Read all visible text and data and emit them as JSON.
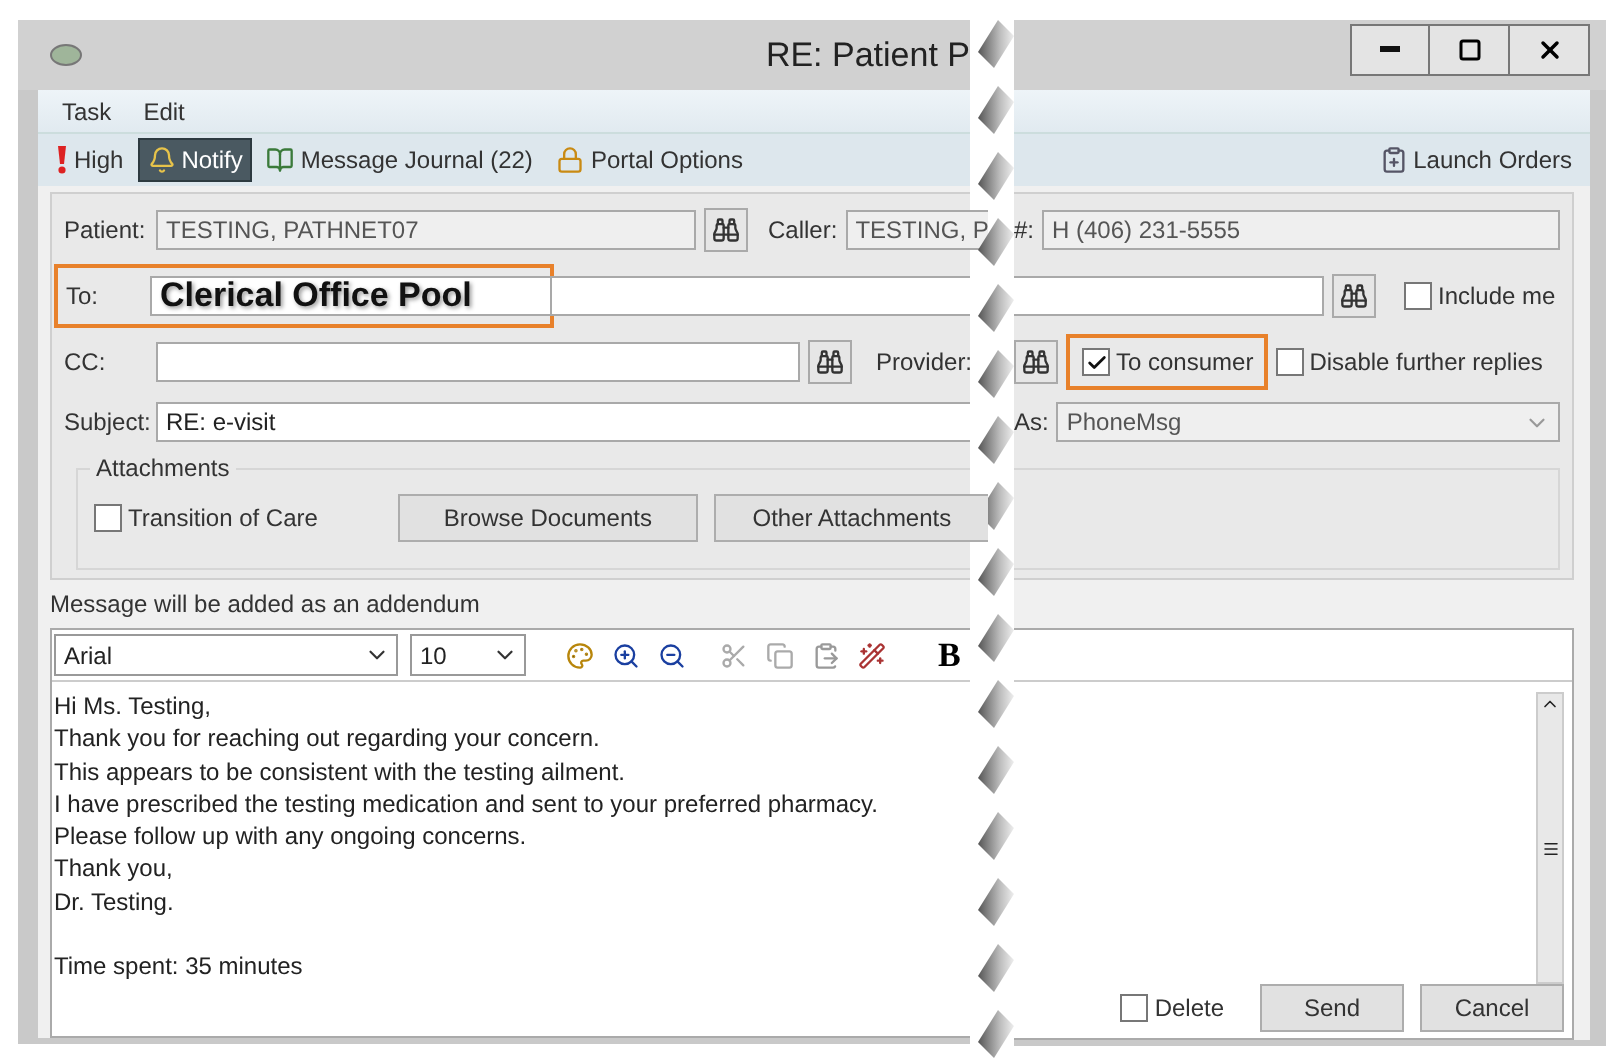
{
  "window": {
    "title": "RE: Patient P"
  },
  "menu": [
    {
      "label": "Task"
    },
    {
      "label": "Edit"
    }
  ],
  "toolbar": [
    {
      "kind": "priority",
      "label": "High",
      "selected": false
    },
    {
      "kind": "notify",
      "label": "Notify",
      "selected": true
    },
    {
      "kind": "journal",
      "label": "Message Journal (22)",
      "selected": false
    },
    {
      "kind": "portal",
      "label": "Portal Options",
      "selected": false
    }
  ],
  "launch_orders": "Launch Orders",
  "patient": {
    "label": "Patient:",
    "value": "TESTING, PATHNET07"
  },
  "caller": {
    "label": "Caller:",
    "value": "TESTING, P"
  },
  "phone": {
    "label": "#:",
    "value": "H (406) 231-5555"
  },
  "to": {
    "label": "To:",
    "value": "Clerical Office Pool",
    "highlighted": true
  },
  "include_me": {
    "label": "Include me",
    "checked": false
  },
  "cc": {
    "label": "CC:"
  },
  "provider": {
    "label": "Provider:"
  },
  "to_consumer": {
    "label": "To consumer",
    "checked": true,
    "highlighted": true
  },
  "disable_replies": {
    "label": "Disable further replies",
    "checked": false
  },
  "subject": {
    "label": "Subject:",
    "value": "RE: e-visit"
  },
  "as": {
    "label": "As:",
    "value": "PhoneMsg"
  },
  "attachments": {
    "legend": "Attachments",
    "transition_of_care": {
      "label": "Transition of Care",
      "checked": false
    },
    "buttons": [
      "Browse Documents",
      "Other Attachments"
    ]
  },
  "addendum_note": "Message will be added as an addendum",
  "editor": {
    "font": "Arial",
    "size": "10",
    "bold": "B",
    "paragraphs": [
      [
        "Hi Ms. Testing,",
        "Thank you for reaching out regarding your concern.",
        "This appears to be consistent with the testing ailment.",
        "I have prescribed the testing medication and sent to your preferred pharmacy.",
        "Please follow up with any ongoing concerns.",
        "Thank you,",
        "Dr. Testing."
      ],
      [
        "Time spent: 35 minutes"
      ]
    ]
  },
  "delete": {
    "label": "Delete",
    "checked": false
  },
  "buttons": [
    "Send",
    "Cancel"
  ]
}
